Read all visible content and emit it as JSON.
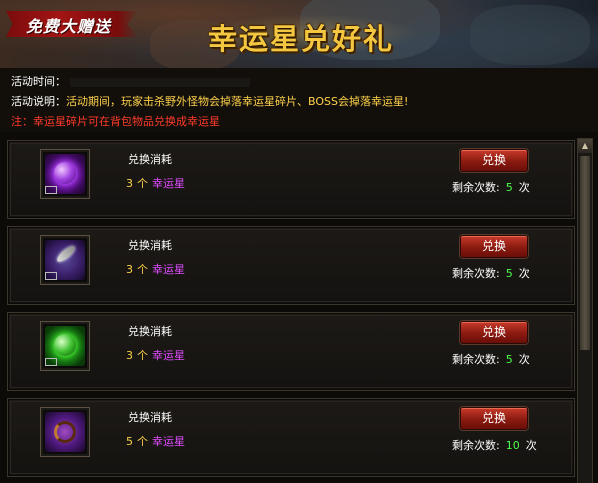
{
  "banner": {
    "ribbon_text": "免费大赠送",
    "title": "幸运星兑好礼"
  },
  "info": {
    "time_label": "活动时间：",
    "desc_label": "活动说明：",
    "desc_text": "活动期间，玩家击杀野外怪物会掉落幸运星碎片、BOSS会掉落幸运星!",
    "note": "注：幸运星碎片可在背包物品兑换成幸运星"
  },
  "colors": {
    "accent_gold": "#f5c740",
    "note_red": "#ff3a2a",
    "item_purple": "#e14cff",
    "count_green": "#4cff4c",
    "button_red": "#8a1a10"
  },
  "rewards": [
    {
      "icon": "purple-orb-icon",
      "cost_label": "兑换消耗",
      "cost_qty": "3",
      "cost_unit": "个",
      "cost_item": "幸运星",
      "button": "兑换",
      "remain_label": "剩余次数:",
      "remain_count": "5",
      "remain_unit": "次"
    },
    {
      "icon": "feather-icon",
      "cost_label": "兑换消耗",
      "cost_qty": "3",
      "cost_unit": "个",
      "cost_item": "幸运星",
      "button": "兑换",
      "remain_label": "剩余次数:",
      "remain_count": "5",
      "remain_unit": "次"
    },
    {
      "icon": "green-orb-icon",
      "cost_label": "兑换消耗",
      "cost_qty": "3",
      "cost_unit": "个",
      "cost_item": "幸运星",
      "button": "兑换",
      "remain_label": "剩余次数:",
      "remain_count": "5",
      "remain_unit": "次"
    },
    {
      "icon": "ring-icon",
      "cost_label": "兑换消耗",
      "cost_qty": "5",
      "cost_unit": "个",
      "cost_item": "幸运星",
      "button": "兑换",
      "remain_label": "剩余次数:",
      "remain_count": "10",
      "remain_unit": "次"
    }
  ],
  "scrollbar": {
    "up_icon": "scroll-up-arrow-icon"
  }
}
